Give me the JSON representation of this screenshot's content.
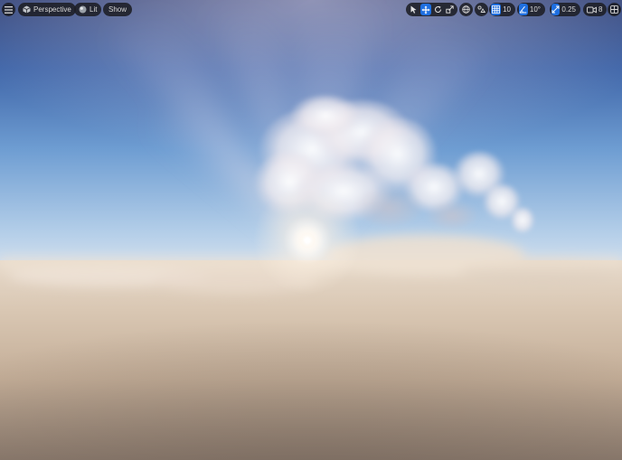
{
  "toolbar": {
    "menu_icon": "hamburger-menu-icon",
    "perspective_label": "Perspective",
    "lit_label": "Lit",
    "show_label": "Show",
    "grid_snap_value": "10",
    "rotation_snap_value": "10°",
    "scale_snap_value": "0.25",
    "camera_speed_value": "8"
  },
  "colors": {
    "sky_top": "#3a4f86",
    "sky_mid": "#5a88c2",
    "horizon": "#bcd3ea",
    "cloud_floor": "#d6c6b2",
    "cloud_floor_dark": "#7e6f62",
    "accent": "#1f6fe0"
  }
}
